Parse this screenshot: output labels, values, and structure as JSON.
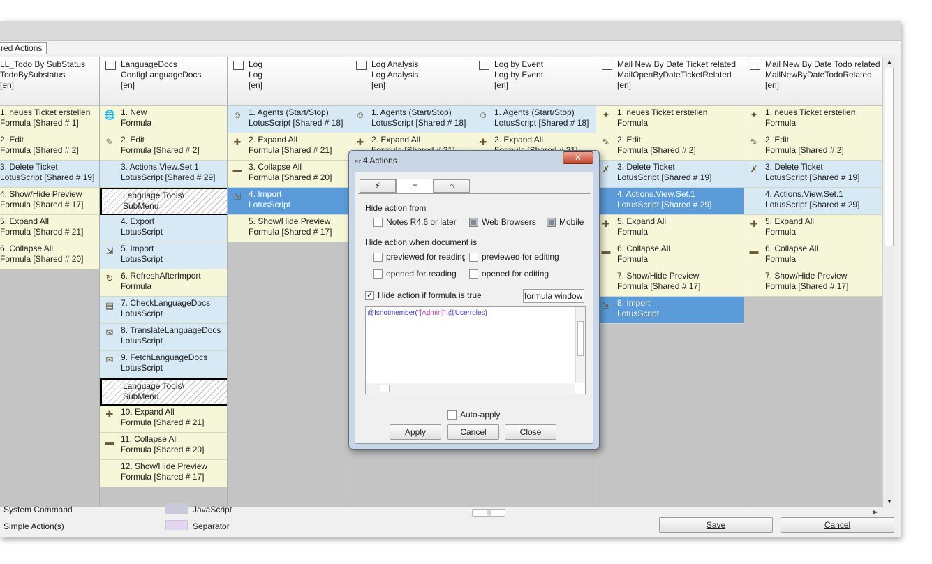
{
  "tab": {
    "label": "red Actions"
  },
  "columns": [
    {
      "header": [
        "LL_Todo By SubStatus",
        "TodoBySubstatus",
        "[en]"
      ],
      "cells": [
        {
          "l1": "1. neues Ticket erstellen",
          "l2": "Formula [Shared # 1]",
          "c": "y"
        },
        {
          "l1": "2. Edit",
          "l2": "Formula [Shared # 2]",
          "c": "y"
        },
        {
          "l1": "3. Delete Ticket",
          "l2": "LotusScript [Shared # 19]",
          "c": "b"
        },
        {
          "l1": "4. Show/Hide Preview",
          "l2": "Formula [Shared # 17]",
          "c": "y"
        },
        {
          "l1": "5. Expand All",
          "l2": "Formula [Shared # 21]",
          "c": "y"
        },
        {
          "l1": "6. Collapse All",
          "l2": "Formula [Shared # 20]",
          "c": "y"
        }
      ]
    },
    {
      "header": [
        "LanguageDocs",
        "ConfigLanguageDocs",
        "[en]"
      ],
      "cells": [
        {
          "l1": "1. New",
          "l2": "Formula",
          "c": "y",
          "icon": "globe-icon"
        },
        {
          "l1": "2. Edit",
          "l2": "Formula [Shared # 2]",
          "c": "y",
          "icon": "edit-icon"
        },
        {
          "l1": "3. Actions.View.Set.1",
          "l2": "LotusScript [Shared # 29]",
          "c": "b"
        },
        {
          "l1": "Language Tools\\",
          "l2": "SubMenu",
          "c": "sub"
        },
        {
          "l1": "4. Export",
          "l2": "LotusScript",
          "c": "b"
        },
        {
          "l1": "5. Import",
          "l2": "LotusScript",
          "c": "b",
          "icon": "import-icon"
        },
        {
          "l1": "6. RefreshAfterImport",
          "l2": "Formula",
          "c": "y",
          "icon": "refresh-icon"
        },
        {
          "l1": "7. CheckLanguageDocs",
          "l2": "LotusScript",
          "c": "b",
          "icon": "book-icon"
        },
        {
          "l1": "8. TranslateLanguageDocs",
          "l2": "LotusScript",
          "c": "b",
          "icon": "translate-icon"
        },
        {
          "l1": "9. FetchLanguageDocs",
          "l2": "LotusScript",
          "c": "b",
          "icon": "fetch-icon"
        },
        {
          "l1": "Language Tools\\",
          "l2": "SubMenu",
          "c": "sub"
        },
        {
          "l1": "10. Expand All",
          "l2": "Formula [Shared # 21]",
          "c": "y",
          "icon": "expand-icon"
        },
        {
          "l1": "11. Collapse All",
          "l2": "Formula [Shared # 20]",
          "c": "y",
          "icon": "collapse-icon"
        },
        {
          "l1": "12. Show/Hide Preview",
          "l2": "Formula [Shared # 17]",
          "c": "y"
        }
      ]
    },
    {
      "header": [
        "Log",
        "Log",
        "[en]"
      ],
      "cells": [
        {
          "l1": "1. Agents (Start/Stop)",
          "l2": "LotusScript [Shared # 18]",
          "c": "b",
          "icon": "agent-icon"
        },
        {
          "l1": "2. Expand All",
          "l2": "Formula [Shared # 21]",
          "c": "y",
          "icon": "expand-icon"
        },
        {
          "l1": "3. Collapse All",
          "l2": "Formula [Shared # 20]",
          "c": "y",
          "icon": "collapse-icon"
        },
        {
          "l1": "4. Import",
          "l2": "LotusScript",
          "c": "s",
          "icon": "import-icon"
        },
        {
          "l1": "5. Show/Hide Preview",
          "l2": "Formula [Shared # 17]",
          "c": "y"
        }
      ]
    },
    {
      "header": [
        "Log Analysis",
        "Log Analysis",
        "[en]"
      ],
      "cells": [
        {
          "l1": "1. Agents (Start/Stop)",
          "l2": "LotusScript [Shared # 18]",
          "c": "b",
          "icon": "agent-icon"
        },
        {
          "l1": "2. Expand All",
          "l2": "Formula [Shared # 21]",
          "c": "y",
          "icon": "expand-icon"
        }
      ]
    },
    {
      "header": [
        "Log by Event",
        "Log by Event",
        "[en]"
      ],
      "cells": [
        {
          "l1": "1. Agents (Start/Stop)",
          "l2": "LotusScript [Shared # 18]",
          "c": "b",
          "icon": "agent-icon"
        },
        {
          "l1": "2. Expand All",
          "l2": "Formula [Shared # 21]",
          "c": "y",
          "icon": "expand-icon"
        }
      ]
    },
    {
      "header": [
        "Mail New By Date Ticket related",
        "MailOpenByDateTicketRelated",
        "[en]"
      ],
      "cells": [
        {
          "l1": "1. neues Ticket erstellen",
          "l2": "Formula",
          "c": "y",
          "icon": "new-ticket-icon"
        },
        {
          "l1": "2. Edit",
          "l2": "Formula [Shared # 2]",
          "c": "y",
          "icon": "edit-icon"
        },
        {
          "l1": "3. Delete Ticket",
          "l2": "LotusScript [Shared # 19]",
          "c": "b",
          "icon": "delete-icon"
        },
        {
          "l1": "4. Actions.View.Set.1",
          "l2": "LotusScript [Shared # 29]",
          "c": "s"
        },
        {
          "l1": "5. Expand All",
          "l2": "Formula",
          "c": "y",
          "icon": "expand-icon"
        },
        {
          "l1": "6. Collapse All",
          "l2": "Formula",
          "c": "y",
          "icon": "collapse-icon"
        },
        {
          "l1": "7. Show/Hide Preview",
          "l2": "Formula [Shared # 17]",
          "c": "y"
        },
        {
          "l1": "8. Import",
          "l2": "LotusScript",
          "c": "s",
          "icon": "import-icon"
        }
      ]
    },
    {
      "header": [
        "Mail New By Date Todo related",
        "MailNewByDateTodoRelated",
        "[en]"
      ],
      "cells": [
        {
          "l1": "1. neues Ticket erstellen",
          "l2": "Formula",
          "c": "y",
          "icon": "new-ticket-icon"
        },
        {
          "l1": "2. Edit",
          "l2": "Formula [Shared # 2]",
          "c": "y",
          "icon": "edit-icon"
        },
        {
          "l1": "3. Delete Ticket",
          "l2": "LotusScript [Shared # 19]",
          "c": "b",
          "icon": "delete-icon"
        },
        {
          "l1": "4. Actions.View.Set.1",
          "l2": "LotusScript [Shared # 29]",
          "c": "b"
        },
        {
          "l1": "5. Expand All",
          "l2": "Formula",
          "c": "y",
          "icon": "expand-icon"
        },
        {
          "l1": "6. Collapse All",
          "l2": "Formula",
          "c": "y",
          "icon": "collapse-icon"
        },
        {
          "l1": "7. Show/Hide Preview",
          "l2": "Formula [Shared # 17]",
          "c": "y"
        }
      ]
    }
  ],
  "legend": {
    "system_command": "System Command",
    "simple_actions": "Simple Action(s)",
    "javascript": "JavaScript",
    "separator": "Separator",
    "javascript_color": "#c9c9dc",
    "separator_color": "#e4d6f0"
  },
  "buttons": {
    "save": "Save",
    "cancel": "Cancel"
  },
  "dialog": {
    "title": "4 Actions",
    "close": "✕",
    "hide_from_label": "Hide action from",
    "notes": "Notes R4.6 or later",
    "web": "Web Browsers",
    "mobile": "Mobile",
    "hide_when_label": "Hide action when document is",
    "prev_read": "previewed for reading",
    "prev_edit": "previewed for editing",
    "open_read": "opened for reading",
    "open_edit": "opened for editing",
    "formula_check": "Hide action if formula is true",
    "formula_window": "formula window",
    "code_fn": "@Isnotmember(",
    "code_str": "\"[Admin]\"",
    "code_rest": ";@Userroles)",
    "auto_apply": "Auto-apply",
    "apply": "Apply",
    "cancel": "Cancel",
    "close_btn": "Close"
  }
}
